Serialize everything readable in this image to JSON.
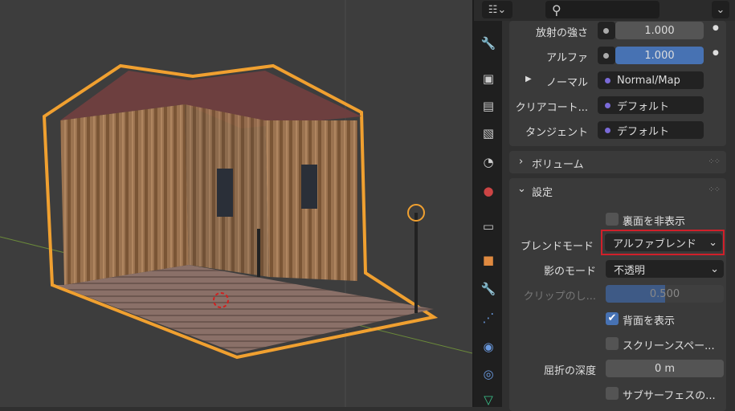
{
  "header": {
    "search_placeholder": ""
  },
  "surface_rows": [
    {
      "label": "放射の強さ",
      "value": "1.000"
    },
    {
      "label": "アルファ",
      "value": "1.000"
    },
    {
      "label": "ノーマル",
      "value": "Normal/Map"
    },
    {
      "label": "クリアコート...",
      "value": "デフォルト"
    },
    {
      "label": "タンジェント",
      "value": "デフォルト"
    }
  ],
  "panels": {
    "volume": "ボリューム",
    "settings": "設定"
  },
  "settings": {
    "backface_culling": "裏面を非表示",
    "blend_mode_label": "ブレンドモード",
    "blend_mode_value": "アルファブレンド",
    "shadow_mode_label": "影のモード",
    "shadow_mode_value": "不透明",
    "clip_label": "クリップのし...",
    "clip_value": "0.500",
    "clip_fraction": 0.5,
    "show_backface": "背面を表示",
    "show_backface_checked": true,
    "screen_space": "スクリーンスペー...",
    "refraction_label": "屈折の深度",
    "refraction_value": "0 m",
    "subsurface": "サブサーフェスの..."
  },
  "colors": {
    "highlight": "#d0202a",
    "accent": "#4772b3",
    "selection": "#f0a030"
  }
}
